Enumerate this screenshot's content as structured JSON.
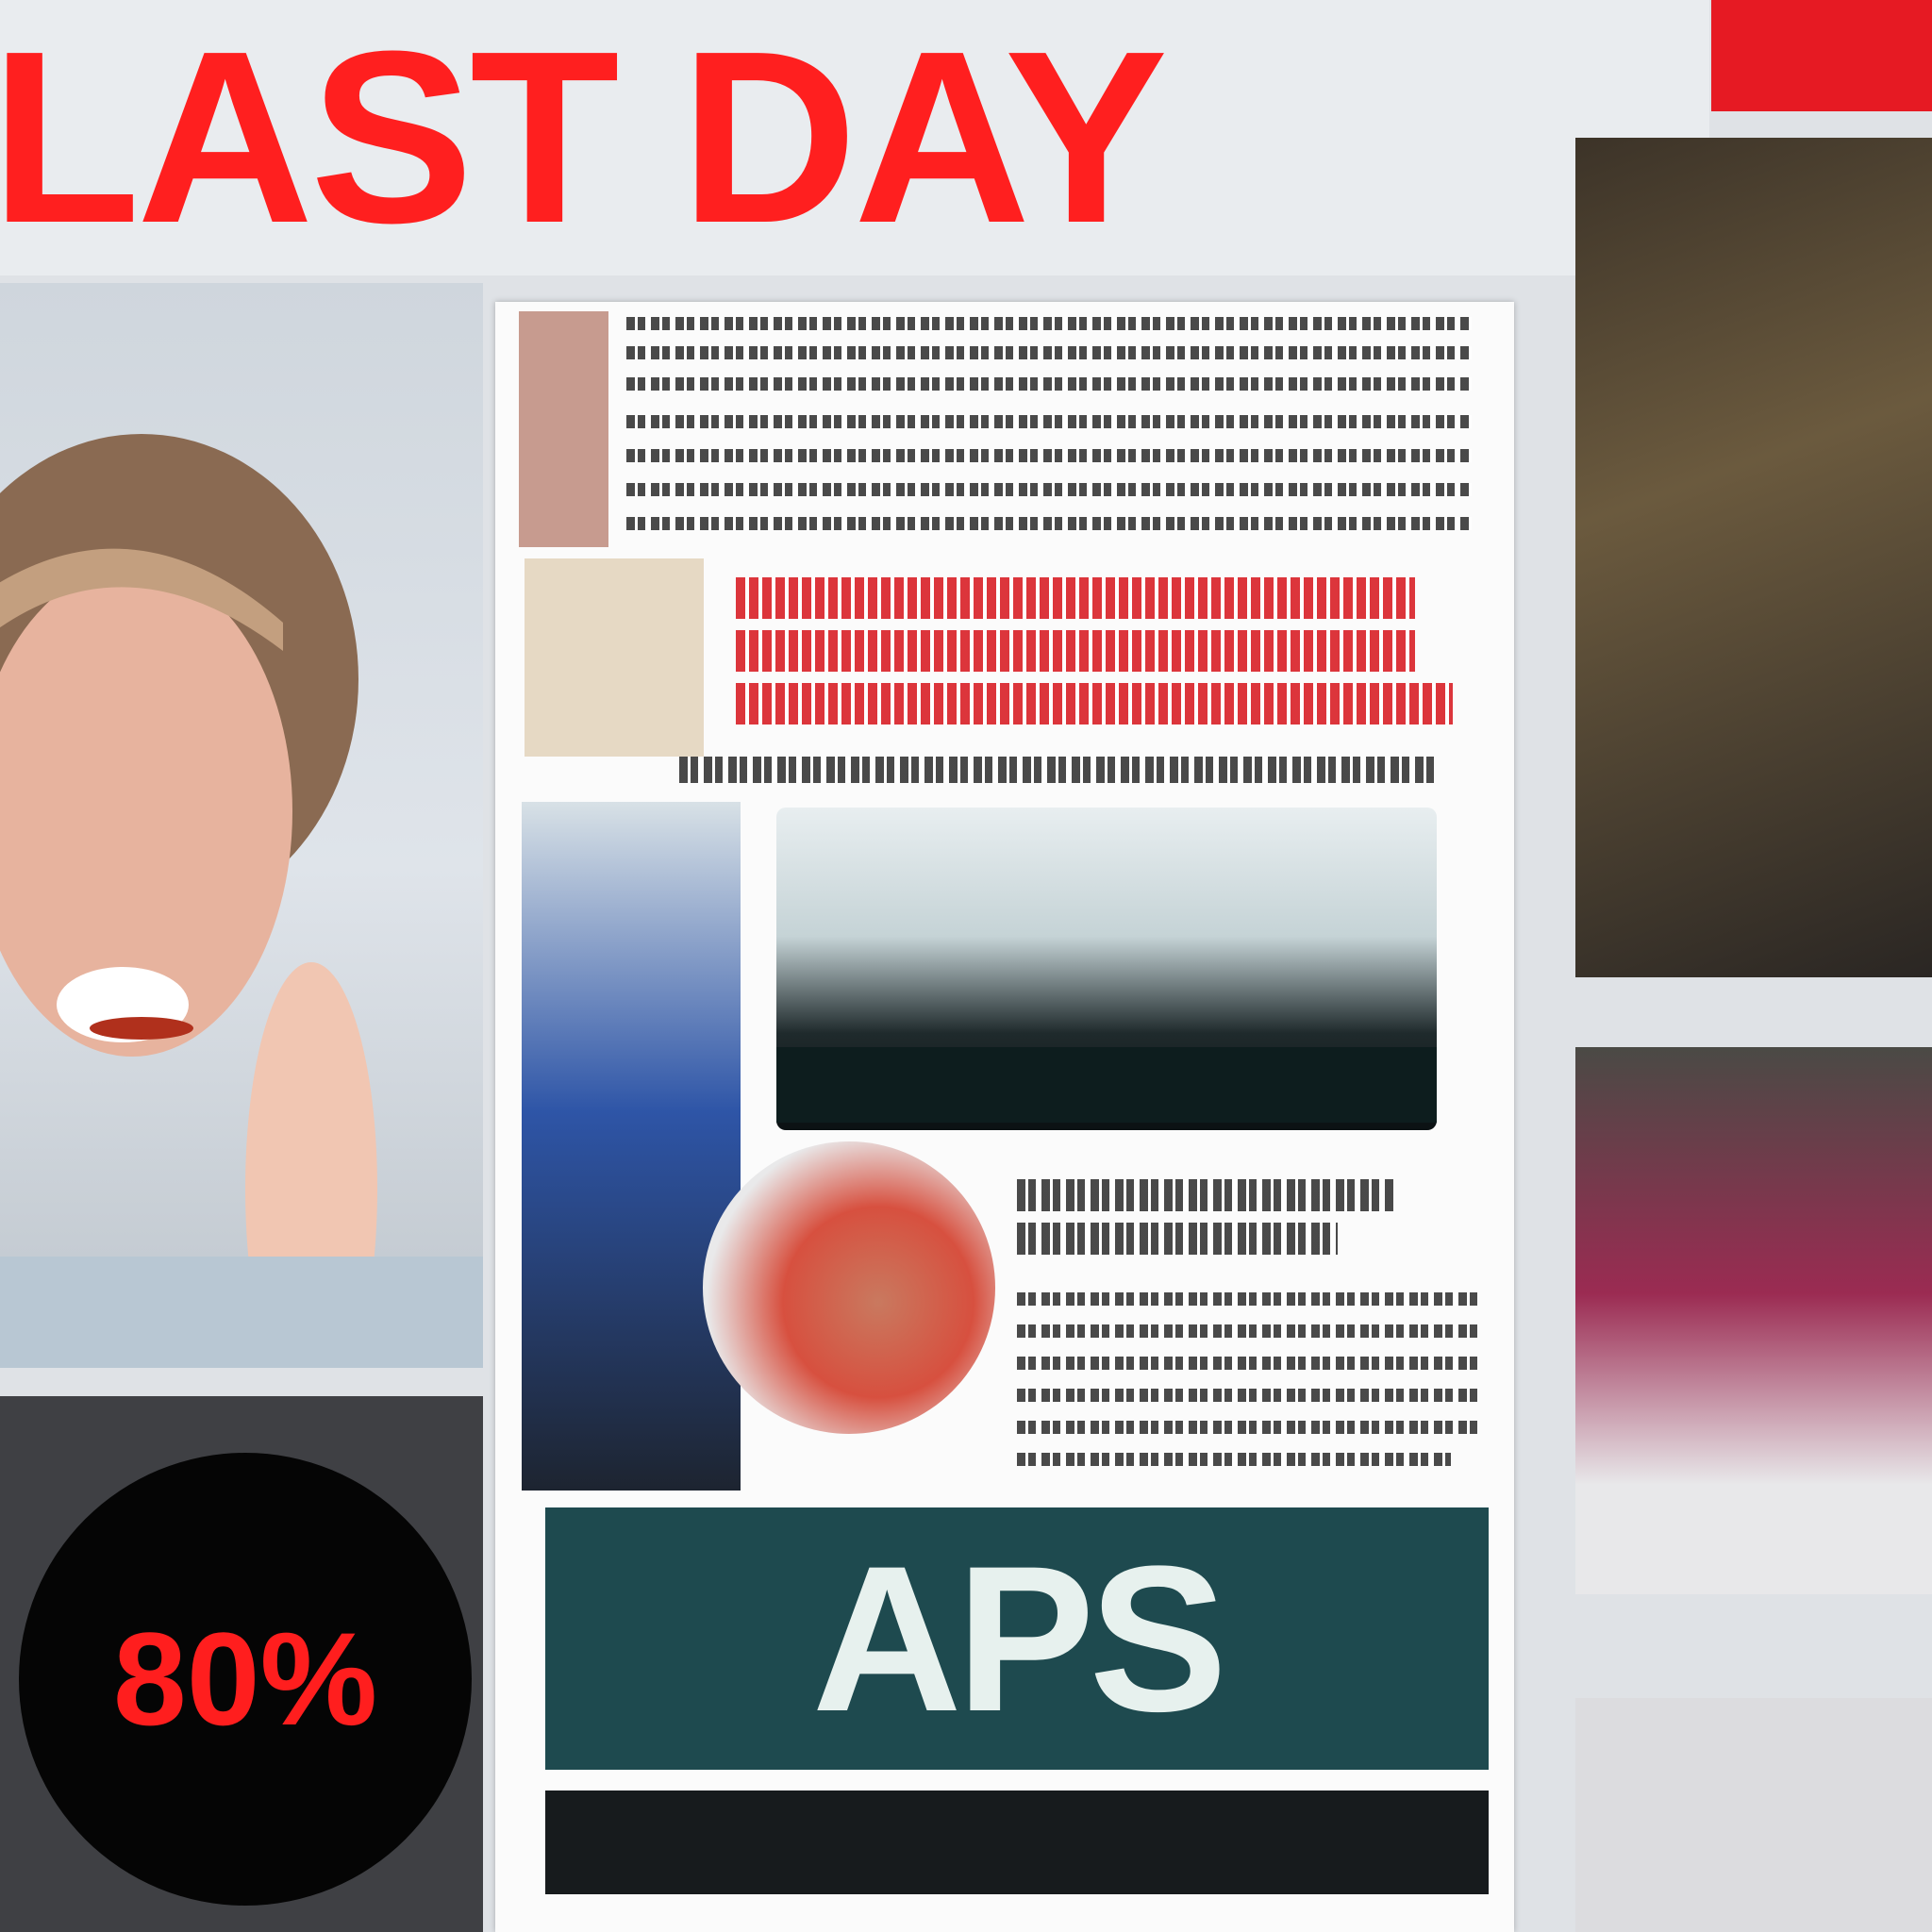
{
  "banner": {
    "headline": "LAST DAY"
  },
  "corner": {
    "text": "๜"
  },
  "promo": {
    "discount": "80%"
  },
  "center": {
    "logo": "APS"
  },
  "colors": {
    "red": "#ff1f1f",
    "teal": "#1e4a4f",
    "dark": "#171b1d"
  },
  "icons": [
    "face-photo",
    "product-photo"
  ]
}
